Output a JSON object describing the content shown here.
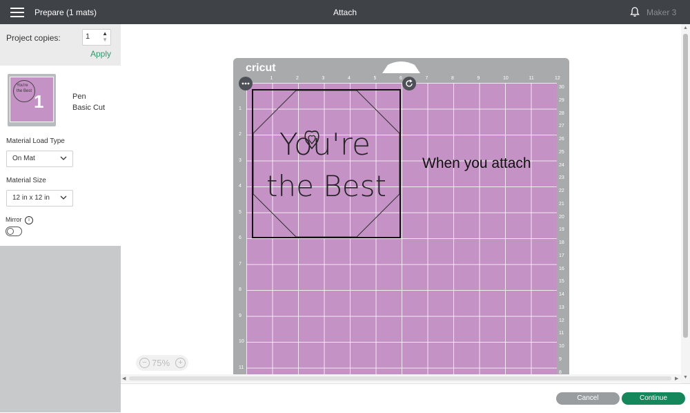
{
  "header": {
    "prepare_label": "Prepare (1 mats)",
    "center_title": "Attach",
    "machine": "Maker 3"
  },
  "sidebar": {
    "copies_label": "Project copies:",
    "copies_value": "1",
    "apply_label": "Apply",
    "mat_number": "1",
    "mat_thumb_text": [
      "You're",
      "the Best"
    ],
    "tool_label": "Pen",
    "cut_label": "Basic Cut",
    "load_type_label": "Material Load Type",
    "load_type_value": "On Mat",
    "size_label": "Material Size",
    "size_value": "12 in x 12 in",
    "mirror_label": "Mirror",
    "mirror_on": false
  },
  "canvas": {
    "brand": "cricut",
    "design_line1": "You're",
    "design_line2": "the Best",
    "annotation": "When you attach",
    "ruler_top": [
      "1",
      "2",
      "3",
      "4",
      "5",
      "6",
      "7",
      "8",
      "9",
      "10",
      "11",
      "12"
    ],
    "ruler_left": [
      "1",
      "2",
      "3",
      "4",
      "5",
      "6",
      "7",
      "8",
      "9",
      "10",
      "11"
    ],
    "ruler_right": [
      "30",
      "29",
      "28",
      "27",
      "26",
      "25",
      "24",
      "23",
      "22",
      "21",
      "20",
      "19",
      "18",
      "17",
      "16",
      "15",
      "14",
      "13",
      "12",
      "11",
      "10",
      "9",
      "8"
    ],
    "mat_color": "#c592c5"
  },
  "zoom": {
    "value": "75%"
  },
  "footer": {
    "cancel_label": "Cancel",
    "continue_label": "Continue"
  },
  "colors": {
    "topbar": "#3f4246",
    "accent_green": "#14885a",
    "apply_green": "#2c9a6a"
  }
}
